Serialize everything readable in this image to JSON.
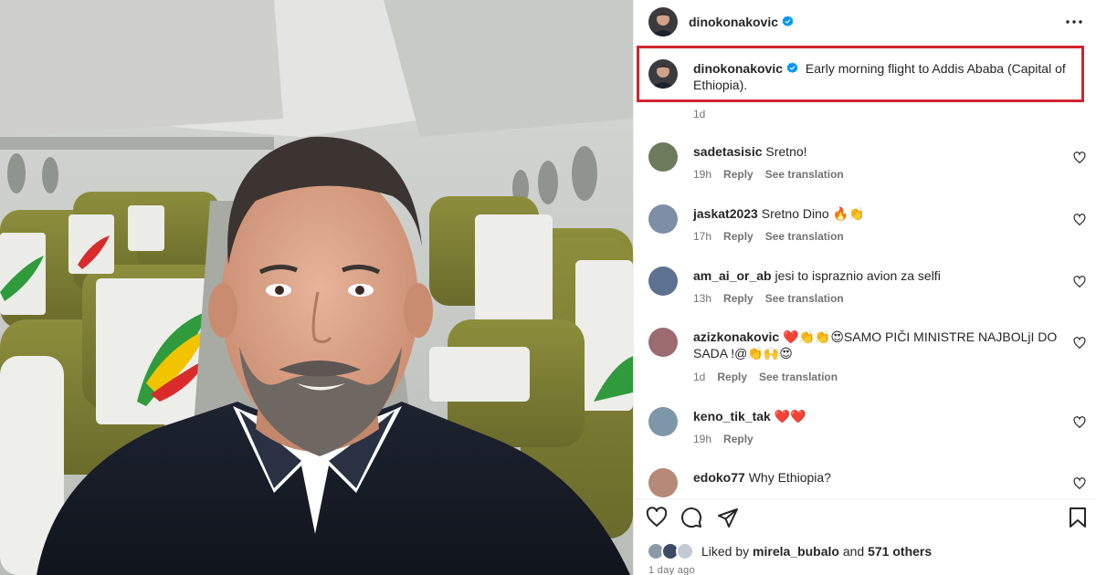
{
  "post": {
    "author": "dinokonakovic",
    "more_icon": "more-horizontal-icon",
    "caption_text": "Early morning flight to Addis Ababa (Capital of Ethiopia).",
    "caption_time": "1d",
    "date": "1 day ago"
  },
  "comments": [
    {
      "user": "sadetasisic",
      "text": "Sretno!",
      "time": "19h",
      "reply": "Reply",
      "translate": "See translation",
      "avatar_color": "#6d7a5c"
    },
    {
      "user": "jaskat2023",
      "text": "Sretno Dino 🔥👏",
      "time": "17h",
      "reply": "Reply",
      "translate": "See translation",
      "avatar_color": "#7d8ea6"
    },
    {
      "user": "am_ai_or_ab",
      "text": "jesi to ispraznio avion za selfi",
      "time": "13h",
      "reply": "Reply",
      "translate": "See translation",
      "avatar_color": "#5c7290"
    },
    {
      "user": "azizkonakovic",
      "text": "❤️👏👏😍SAMO PIČI MINISTRE NAJBOLjI DO SADA !@👏🙌😍",
      "time": "1d",
      "reply": "Reply",
      "translate": "See translation",
      "avatar_color": "#9b6b70"
    },
    {
      "user": "keno_tik_tak",
      "text": "❤️❤️",
      "time": "19h",
      "reply": "Reply",
      "translate": "",
      "avatar_color": "#7d96a8"
    },
    {
      "user": "edoko77",
      "text": "Why Ethiopia?",
      "time": "",
      "reply": "",
      "translate": "",
      "avatar_color": "#b58a78"
    }
  ],
  "likes": {
    "prefix": "Liked by",
    "user": "mirela_bubalo",
    "joiner": "and",
    "others": "571 others"
  },
  "icons": {
    "like": "heart-icon",
    "comment": "comment-icon",
    "share": "share-icon",
    "save": "bookmark-icon",
    "verified": "verified-badge-icon"
  },
  "colors": {
    "verified": "#0095f6",
    "highlight_box": "#d1252f",
    "meta_text": "#737373"
  }
}
